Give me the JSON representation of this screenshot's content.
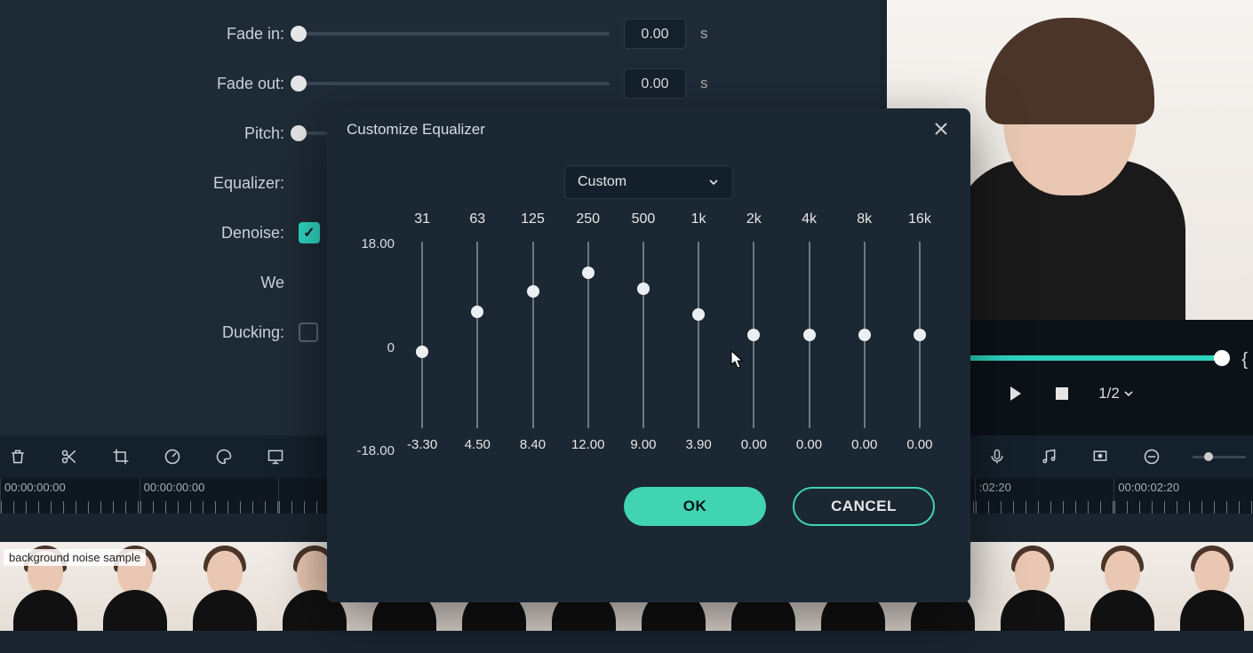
{
  "audio_panel": {
    "rows": [
      {
        "label": "Fade in:",
        "value": "0.00",
        "unit": "s",
        "thumb_pct": 0
      },
      {
        "label": "Fade out:",
        "value": "0.00",
        "unit": "s",
        "thumb_pct": 0
      },
      {
        "label": "Pitch:",
        "value": "",
        "unit": "",
        "thumb_pct": 0
      },
      {
        "label": "Equalizer:",
        "value": "",
        "unit": "",
        "thumb_pct": null
      },
      {
        "label": "Denoise:",
        "value": "",
        "unit": "",
        "checked": true
      },
      {
        "label": "We",
        "value": "",
        "unit": ""
      },
      {
        "label": "Ducking:",
        "value": "",
        "unit": "",
        "checked": false
      }
    ]
  },
  "ruler": [
    "00:00:00:00",
    "00:00:00:00",
    "",
    "",
    "",
    "",
    "",
    ":02:20",
    "00:00:02:20"
  ],
  "clip_name": "background noise sample",
  "transport": {
    "speed": "1/2"
  },
  "dialog": {
    "title": "Customize Equalizer",
    "preset": "Custom",
    "axis": {
      "max": "18.00",
      "mid": "0",
      "min": "-18.00"
    },
    "bands": [
      {
        "freq": "31",
        "val": "-3.30",
        "db": -3.3
      },
      {
        "freq": "63",
        "val": "4.50",
        "db": 4.5
      },
      {
        "freq": "125",
        "val": "8.40",
        "db": 8.4
      },
      {
        "freq": "250",
        "val": "12.00",
        "db": 12.0
      },
      {
        "freq": "500",
        "val": "9.00",
        "db": 9.0
      },
      {
        "freq": "1k",
        "val": "3.90",
        "db": 3.9
      },
      {
        "freq": "2k",
        "val": "0.00",
        "db": 0.0
      },
      {
        "freq": "4k",
        "val": "0.00",
        "db": 0.0
      },
      {
        "freq": "8k",
        "val": "0.00",
        "db": 0.0
      },
      {
        "freq": "16k",
        "val": "0.00",
        "db": 0.0
      }
    ],
    "ok": "OK",
    "cancel": "CANCEL"
  }
}
